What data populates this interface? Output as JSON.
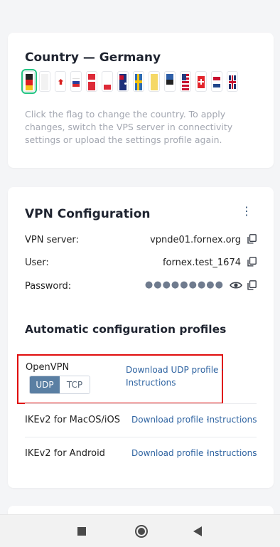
{
  "country": {
    "title": "Country — Germany",
    "hint": "Click the flag to change the country. To apply changes, switch the VPS server in connectivity settings or upload the settings profile again.",
    "flags": [
      {
        "name": "germany",
        "selected": true
      },
      {
        "name": "blank-white"
      },
      {
        "name": "canada"
      },
      {
        "name": "russia"
      },
      {
        "name": "poland"
      },
      {
        "name": "poland-alt"
      },
      {
        "name": "australia"
      },
      {
        "name": "sweden"
      },
      {
        "name": "yellow-white"
      },
      {
        "name": "estonia"
      },
      {
        "name": "usa"
      },
      {
        "name": "switzerland"
      },
      {
        "name": "netherlands"
      },
      {
        "name": "uk"
      }
    ]
  },
  "vpn": {
    "title": "VPN Configuration",
    "server_label": "VPN server:",
    "server_value": "vpnde01.fornex.org",
    "user_label": "User:",
    "user_value": "fornex.test_1674",
    "password_label": "Password:",
    "password_mask": "●●●●●●●●●"
  },
  "profiles": {
    "title": "Automatic configuration profiles",
    "openvpn": {
      "name": "OpenVPN",
      "udp": "UDP",
      "tcp": "TCP",
      "download": "Download UDP profile ·",
      "instructions": "Instructions"
    },
    "ikev2_mac": {
      "name": "IKEv2 for MacOS/iOS",
      "download": "Download profile ·",
      "instructions": "Instructions"
    },
    "ikev2_android": {
      "name": "IKEv2 for Android",
      "download": "Download profile ·",
      "instructions": "Instructions"
    }
  },
  "colors": {
    "link": "#2e63a1",
    "selected_flag": "#23c482",
    "highlight": "#e00d0d",
    "segment_active": "#5a7fa3"
  }
}
